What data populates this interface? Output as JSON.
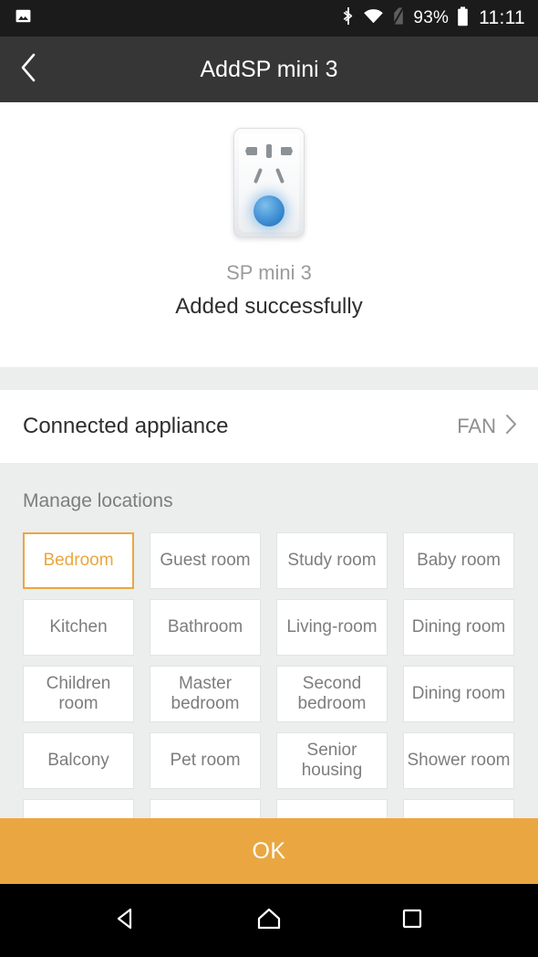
{
  "status_bar": {
    "notification_icon": "image-icon",
    "bluetooth_icon": "bluetooth-icon",
    "wifi_icon": "wifi-icon",
    "no_sim_icon": "no-sim-icon",
    "battery_percent": "93%",
    "battery_icon": "battery-icon",
    "time": "11:11"
  },
  "header": {
    "back_icon": "chevron-left-icon",
    "title": "AddSP mini 3"
  },
  "device": {
    "image_icon": "smart-plug-icon",
    "name": "SP mini 3",
    "status": "Added successfully"
  },
  "appliance": {
    "label": "Connected appliance",
    "value": "FAN",
    "chevron_icon": "chevron-right-icon"
  },
  "locations": {
    "title": "Manage locations",
    "selected": "Bedroom",
    "items": [
      {
        "label": "Bedroom",
        "selected": true,
        "wrap": false
      },
      {
        "label": "Guest room",
        "selected": false,
        "wrap": false
      },
      {
        "label": "Study room",
        "selected": false,
        "wrap": false
      },
      {
        "label": "Baby room",
        "selected": false,
        "wrap": false
      },
      {
        "label": "Kitchen",
        "selected": false,
        "wrap": false
      },
      {
        "label": "Bathroom",
        "selected": false,
        "wrap": false
      },
      {
        "label": "Living-room",
        "selected": false,
        "wrap": false
      },
      {
        "label": "Dining room",
        "selected": false,
        "wrap": false
      },
      {
        "label": "Children room",
        "selected": false,
        "wrap": true
      },
      {
        "label": "Master bedroom",
        "selected": false,
        "wrap": true
      },
      {
        "label": "Second bedroom",
        "selected": false,
        "wrap": true
      },
      {
        "label": "Dining room",
        "selected": false,
        "wrap": false
      },
      {
        "label": "Balcony",
        "selected": false,
        "wrap": false
      },
      {
        "label": "Pet room",
        "selected": false,
        "wrap": false
      },
      {
        "label": "Senior housing",
        "selected": false,
        "wrap": true
      },
      {
        "label": "Shower room",
        "selected": false,
        "wrap": true
      },
      {
        "label": "",
        "selected": false,
        "wrap": false
      },
      {
        "label": "",
        "selected": false,
        "wrap": false
      },
      {
        "label": "",
        "selected": false,
        "wrap": false
      },
      {
        "label": "",
        "selected": false,
        "wrap": false
      }
    ]
  },
  "footer": {
    "ok_label": "OK"
  },
  "navbar": {
    "back_icon": "triangle-back-icon",
    "home_icon": "home-icon",
    "recents_icon": "square-recents-icon"
  },
  "colors": {
    "accent": "#eaa741",
    "status_bar": "#1b1b1b",
    "app_bar": "#363636",
    "page_bg": "#eceded",
    "card_bg": "#ffffff",
    "muted_text": "#7d7d7d",
    "led_blue": "#3d8fd6"
  }
}
